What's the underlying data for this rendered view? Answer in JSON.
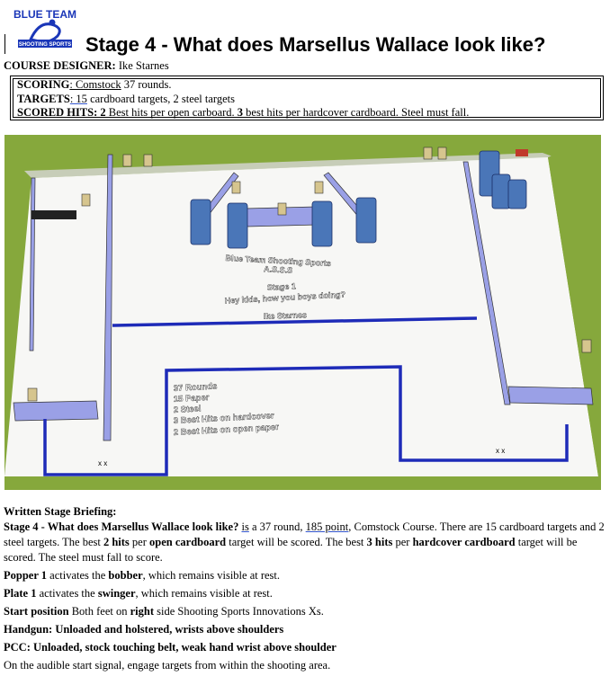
{
  "logo": {
    "line1": "BLUE TEAM",
    "line2": "SHOOTING SPORTS",
    "color": "#1a36b8"
  },
  "header": {
    "title": "Stage 4 - What does Marsellus Wallace look like?"
  },
  "designer": {
    "label": "COURSE DESIGNER:",
    "value": "Ike Starnes"
  },
  "scoring": {
    "scoring_label": "SCORING",
    "scoring_value": ": Comstock",
    "scoring_rest": " 37 rounds.",
    "targets_label": "TARGETS",
    "targets_value": ": 15",
    "targets_rest": " cardboard targets, 2 steel targets",
    "hits_label": "SCORED HITS:",
    "hits_n1": "2",
    "hits_t1": " Best hits per open carboard. ",
    "hits_n2": "3",
    "hits_t2": " best hits per hardcover cardboard. Steel must fall."
  },
  "diagram": {
    "colors": {
      "grass": "#86a83c",
      "floor": "#f7f7f5",
      "wall": "#9aa0e6",
      "tape": "#1e2bb8"
    },
    "sign1": "Blue Team Shooting Sports",
    "sign2": "A.S.S.S",
    "sign3": "Stage 1",
    "sign4": "Hey kids, how you boys doing?",
    "sign5": "Ike Starnes",
    "info": [
      "37 Rounds",
      "15 Paper",
      "2 Steel",
      "3 Best Hits on hardcover",
      "2 Best Hits on open paper"
    ],
    "xmark": "x x"
  },
  "briefing": {
    "heading": "Written Stage Briefing:",
    "p1_title": "Stage 4 - What does Marsellus Wallace look like?",
    "p1_is": "is",
    "p1_a": " a 37 round, ",
    "p1_points": "185 point",
    "p1_b": ", Comstock Course. There are 15 cardboard targets and 2 steel targets. The best ",
    "p1_hits2": "2 hits",
    "p1_c": " per ",
    "p1_open": "open cardboard",
    "p1_d": " target will be scored. The best ",
    "p1_hits3": "3 hits",
    "p1_e": " per ",
    "p1_hard": "hardcover cardboard",
    "p1_f": " target will be scored. The steel must fall to score.",
    "popper_b": "Popper 1",
    "popper_t1": " activates the ",
    "popper_b2": "bobber",
    "popper_t2": ", which remains visible at rest.",
    "plate_b": "Plate 1",
    "plate_t1": " activates the ",
    "plate_b2": "swinger",
    "plate_t2": ", which remains visible at rest.",
    "start_b": "Start position",
    "start_t1": " Both feet on ",
    "start_b2": "right",
    "start_t2": " side Shooting Sports Innovations Xs.",
    "handgun": "Handgun: Unloaded and holstered, wrists above shoulders",
    "pcc": "PCC: Unloaded, stock touching belt, weak hand wrist above shoulder",
    "final": "On the audible start signal, engage targets from within the shooting area."
  }
}
